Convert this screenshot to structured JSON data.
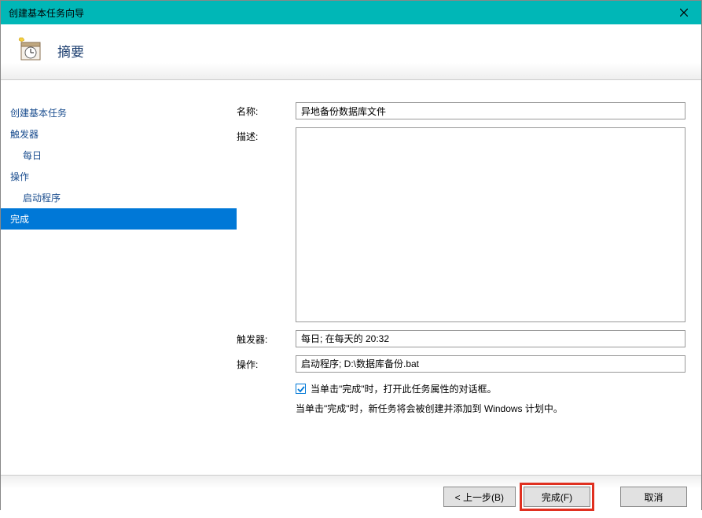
{
  "titlebar": {
    "title": "创建基本任务向导"
  },
  "header": {
    "title": "摘要"
  },
  "sidebar": {
    "items": [
      {
        "label": "创建基本任务",
        "type": "item"
      },
      {
        "label": "触发器",
        "type": "item"
      },
      {
        "label": "每日",
        "type": "subitem"
      },
      {
        "label": "操作",
        "type": "item"
      },
      {
        "label": "启动程序",
        "type": "subitem"
      },
      {
        "label": "完成",
        "type": "item",
        "selected": true
      }
    ]
  },
  "form": {
    "name_label": "名称:",
    "name_value": "异地备份数据库文件",
    "desc_label": "描述:",
    "desc_value": "",
    "trigger_label": "触发器:",
    "trigger_value": "每日;  在每天的 20:32",
    "action_label": "操作:",
    "action_value": "启动程序; D:\\数据库备份.bat",
    "checkbox_label": "当单击\"完成\"时，打开此任务属性的对话框。",
    "info_text": "当单击\"完成\"时，新任务将会被创建并添加到 Windows 计划中。"
  },
  "footer": {
    "back": "< 上一步(B)",
    "finish": "完成(F)",
    "cancel": "取消"
  }
}
